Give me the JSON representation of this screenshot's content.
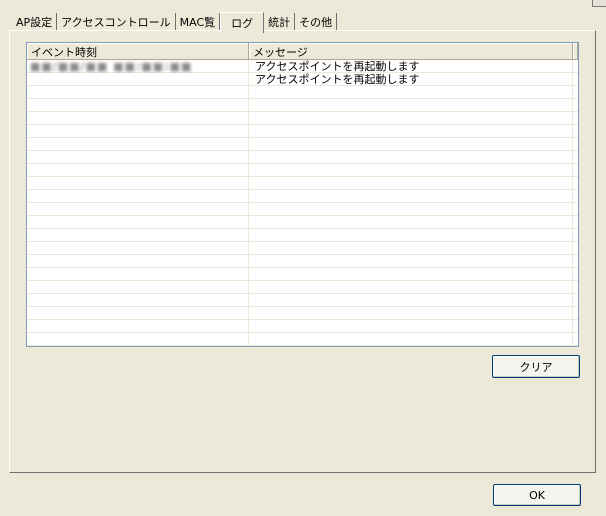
{
  "tabs": [
    {
      "label": "AP設定",
      "active": false
    },
    {
      "label": "アクセスコントロール",
      "active": false
    },
    {
      "label": "MAC覧",
      "active": false
    },
    {
      "label": "ログ",
      "active": true
    },
    {
      "label": "統計",
      "active": false
    },
    {
      "label": "その他",
      "active": false
    }
  ],
  "log_list": {
    "columns": [
      "イベント時刻",
      "メッセージ"
    ],
    "rows": [
      {
        "time": "■■/■■/■■ ■■:■■:■■",
        "message": "アクセスポイントを再起動します"
      },
      {
        "time": "",
        "message": "アクセスポイントを再起動します"
      }
    ]
  },
  "buttons": {
    "clear_label": "クリア",
    "ok_label": "OK"
  },
  "colors": {
    "face": "#ece9d8",
    "list_border": "#7f9db9",
    "button_border": "#003c74"
  }
}
